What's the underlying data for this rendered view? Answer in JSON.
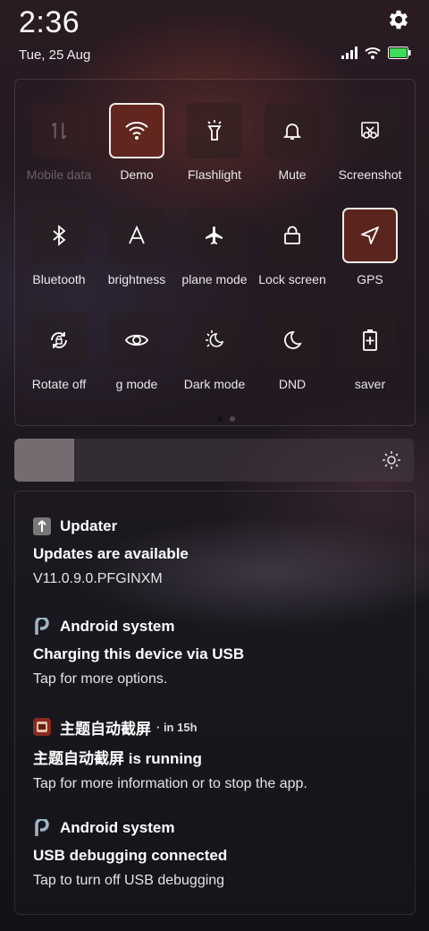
{
  "status_bar": {
    "time": "2:36",
    "date": "Tue, 25 Aug",
    "icons": [
      "signal-icon",
      "wifi-icon",
      "battery-icon"
    ]
  },
  "quick_settings": {
    "row1": [
      {
        "label": "Mobile data",
        "icon": "mobile-data-icon",
        "state": "disabled"
      },
      {
        "label": "Demo",
        "icon": "wifi-icon",
        "state": "active"
      },
      {
        "label": "Flashlight",
        "icon": "flashlight-icon",
        "state": "off"
      },
      {
        "label": "Mute",
        "icon": "bell-icon",
        "state": "off"
      },
      {
        "label": "Screenshot",
        "icon": "scissors-icon",
        "state": "off"
      }
    ],
    "row2": [
      {
        "label": "Bluetooth",
        "icon": "bluetooth-icon",
        "state": "off"
      },
      {
        "label": "brightness",
        "icon": "auto-brightness-icon",
        "state": "off"
      },
      {
        "label": "plane mode",
        "icon": "airplane-icon",
        "state": "off"
      },
      {
        "label": "Lock screen",
        "icon": "lock-icon",
        "state": "off"
      },
      {
        "label": "GPS",
        "icon": "navigation-icon",
        "state": "active"
      }
    ],
    "row3": [
      {
        "label": "Rotate off",
        "icon": "rotate-lock-icon",
        "state": "off"
      },
      {
        "label": "g mode",
        "icon": "eye-icon",
        "state": "off"
      },
      {
        "label": "Dark mode",
        "icon": "dark-mode-icon",
        "state": "off"
      },
      {
        "label": "DND",
        "icon": "moon-icon",
        "state": "off"
      },
      {
        "label": "saver",
        "icon": "battery-saver-icon",
        "state": "off"
      }
    ],
    "page_count": 2,
    "current_page": 1
  },
  "brightness": {
    "level": 0.15,
    "icon": "sun-icon"
  },
  "notifications": [
    {
      "app": "Updater",
      "icon": "updater-icon",
      "time": "",
      "title": "Updates are available",
      "text": "V11.0.9.0.PFGINXM"
    },
    {
      "app": "Android system",
      "icon": "android-p-icon",
      "time": "",
      "title": "Charging this device via USB",
      "text": "Tap for more options."
    },
    {
      "app": "主题自动截屏",
      "icon": "app-thumb-icon",
      "time": "· in 15h",
      "title": "主题自动截屏 is running",
      "text": "Tap for more information or to stop the app."
    },
    {
      "app": "Android system",
      "icon": "android-p-icon",
      "time": "",
      "title": "USB debugging connected",
      "text": "Tap to turn off USB debugging"
    }
  ],
  "colors": {
    "accent_active": "#f3ece6",
    "green_battery": "#3ddc5a"
  }
}
